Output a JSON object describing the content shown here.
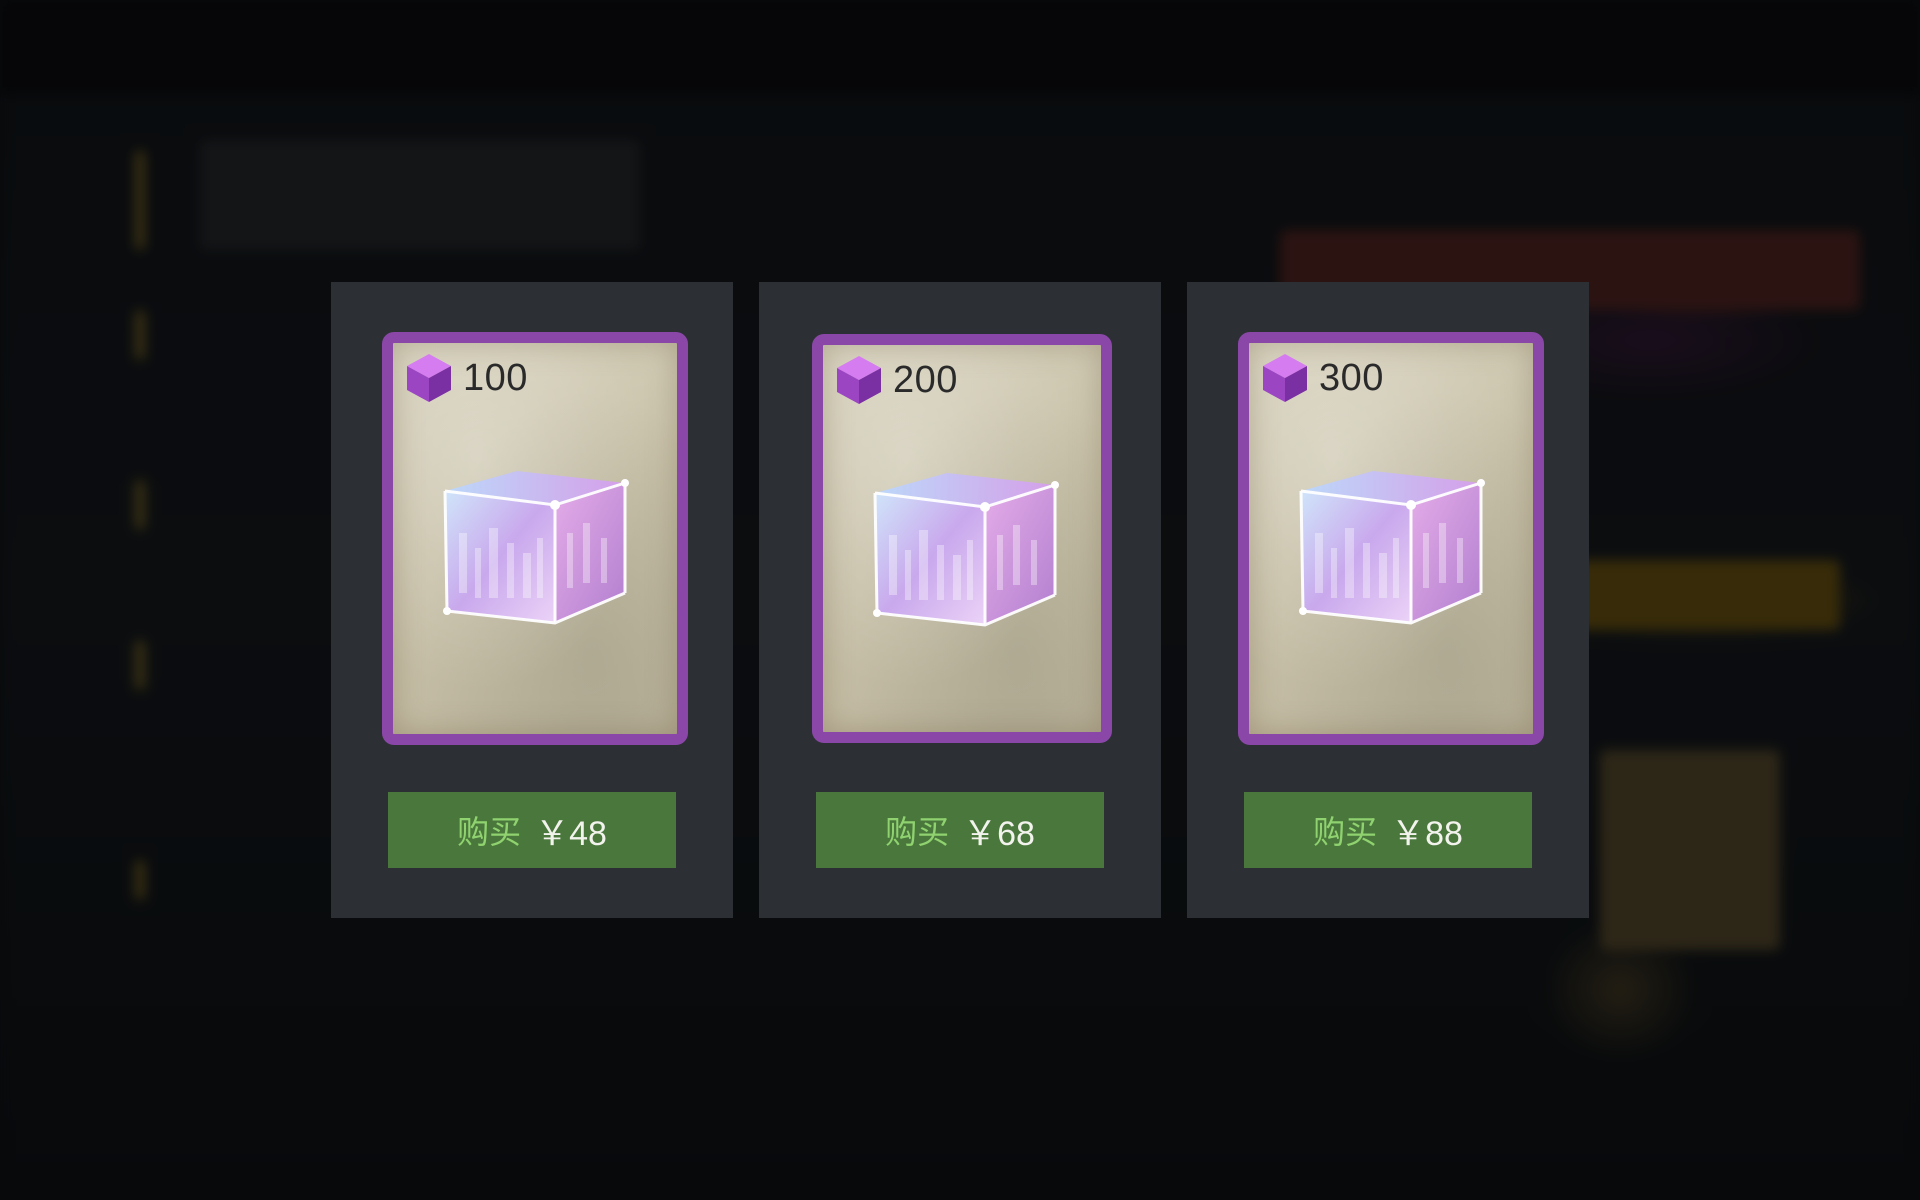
{
  "shop": {
    "items": [
      {
        "amount": "100",
        "buy_label": "购买",
        "price": "￥48"
      },
      {
        "amount": "200",
        "buy_label": "购买",
        "price": "￥68"
      },
      {
        "amount": "300",
        "buy_label": "购买",
        "price": "￥88"
      }
    ]
  },
  "colors": {
    "panel_bg": "#2c2f33",
    "card_border": "#8a47a8",
    "buy_button": "#4a773c",
    "buy_label": "#8fd26f",
    "price_text": "#f1f3ec"
  },
  "icons": {
    "currency": "purple-cube-icon",
    "item_art": "crystal-cube-art"
  }
}
